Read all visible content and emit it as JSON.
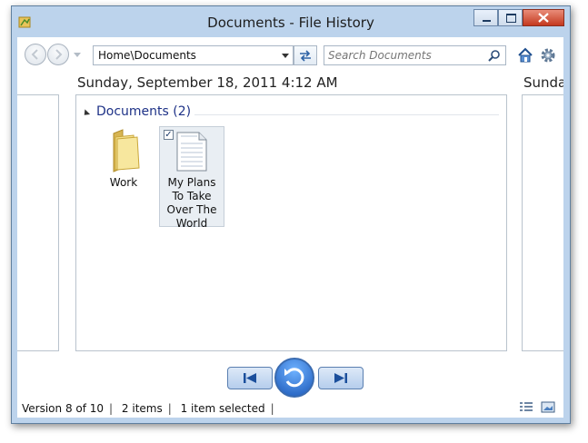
{
  "window": {
    "title": "Documents - File History"
  },
  "toolbar": {
    "address": "Home\\Documents",
    "search_placeholder": "Search Documents"
  },
  "timeline": {
    "current_date": "Sunday, September 18, 2011 4:12 AM",
    "next_date": "Sunday"
  },
  "group": {
    "label": "Documents (2)"
  },
  "items": [
    {
      "label": "Work",
      "icon": "folder-icon"
    },
    {
      "label": "My Plans To Take Over The World",
      "icon": "document-icon",
      "selected": true
    }
  ],
  "status": {
    "version": "Version 8 of 10",
    "count": "2 items",
    "selected": "1 item selected"
  },
  "colors": {
    "frame": "#bcd3ec",
    "group_label": "#1e3287",
    "close_button": "#c4391f",
    "restore_button": "#1a57b8"
  }
}
